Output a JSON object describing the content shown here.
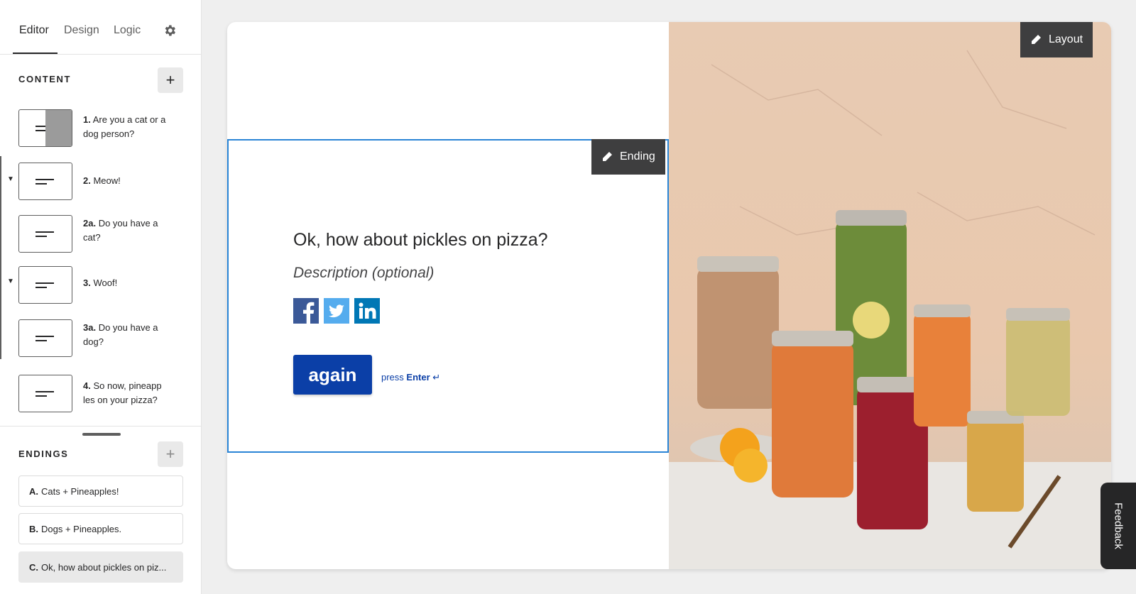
{
  "tabs": [
    {
      "label": "Editor",
      "active": true
    },
    {
      "label": "Design",
      "active": false
    },
    {
      "label": "Logic",
      "active": false
    }
  ],
  "settings_icon": "gear-icon",
  "content": {
    "heading": "CONTENT",
    "add_label": "+",
    "questions": [
      {
        "num": "1.",
        "text": "Are you a cat or a dog person?",
        "has_image": true
      },
      {
        "num": "2.",
        "text": "Meow!",
        "has_image": false,
        "collapsible": true
      },
      {
        "num": "2a.",
        "text": "Do you have a cat?",
        "has_image": false
      },
      {
        "num": "3.",
        "text": "Woof!",
        "has_image": false,
        "collapsible": true
      },
      {
        "num": "3a.",
        "text": "Do you have a dog?",
        "has_image": false
      },
      {
        "num": "4.",
        "text": "So now, pineapp les on your pizza?",
        "has_image": false
      }
    ]
  },
  "endings": {
    "heading": "ENDINGS",
    "add_label": "+",
    "items": [
      {
        "letter": "A.",
        "text": "Cats + Pineapples!",
        "selected": false
      },
      {
        "letter": "B.",
        "text": "Dogs + Pineapples.",
        "selected": false
      },
      {
        "letter": "C.",
        "text": "Ok, how about pickles on piz...",
        "selected": true
      }
    ]
  },
  "canvas": {
    "layout_label": "Layout",
    "ending_label": "Ending",
    "title": "Ok, how about pickles on pizza?",
    "description": "Description (optional)",
    "social": [
      "facebook-icon",
      "twitter-icon",
      "linkedin-icon"
    ],
    "button_label": "again",
    "hint_press": "press",
    "hint_key": "Enter",
    "hint_icon": "↵"
  },
  "feedback_label": "Feedback",
  "colors": {
    "accent": "#0b3fa7",
    "selection": "#2a85d6",
    "dark": "#262627"
  }
}
